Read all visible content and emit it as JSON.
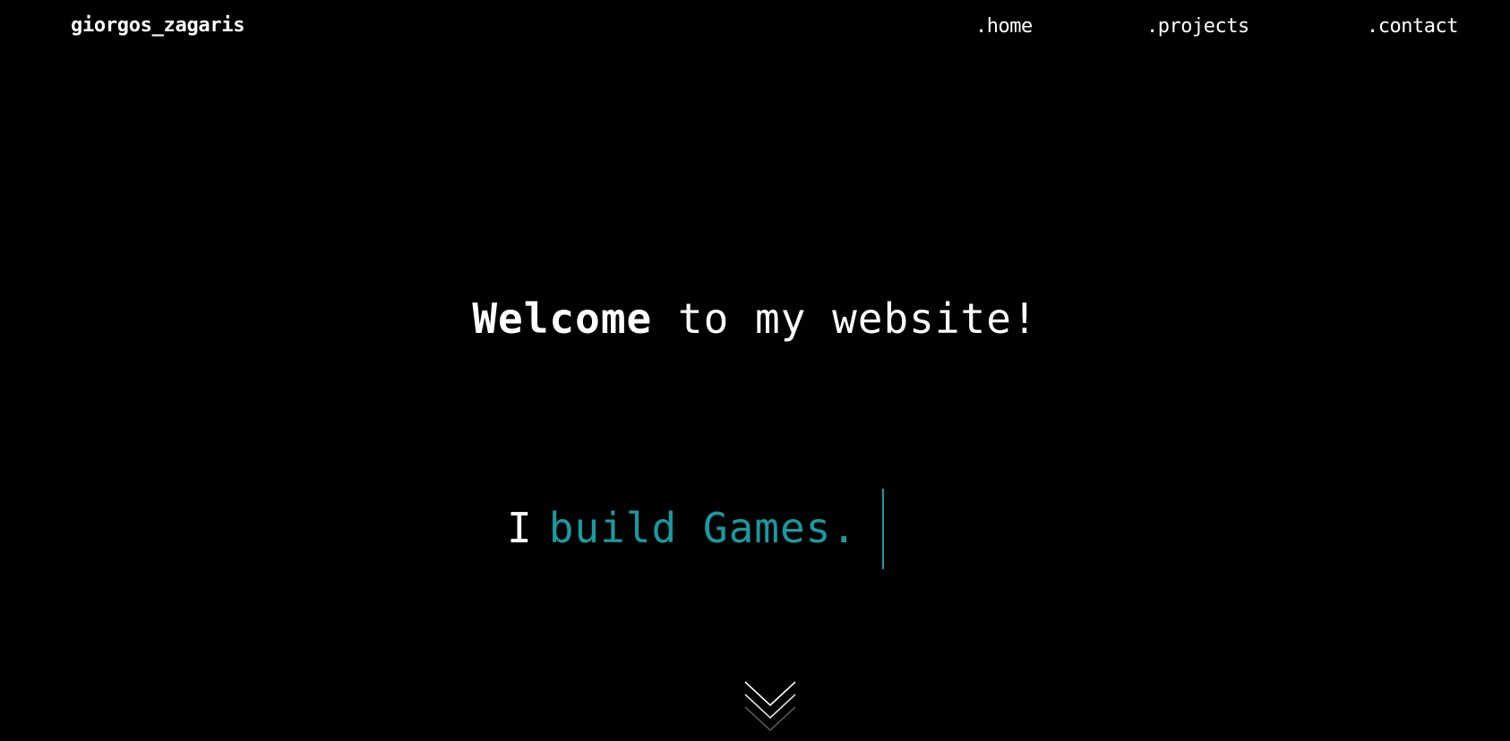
{
  "header": {
    "brand": "giorgos_zagaris",
    "nav": [
      {
        "label": ".home"
      },
      {
        "label": ".projects"
      },
      {
        "label": ".contact"
      }
    ]
  },
  "hero": {
    "welcome_strong": "Welcome",
    "welcome_rest": "to my website!",
    "tagline_prefix": "I",
    "tagline_typed": "build Games."
  },
  "icons": {
    "scroll": "chevron-double-down-icon"
  },
  "colors": {
    "background": "#000000",
    "text": "#ffffff",
    "accent": "#1a9aa0"
  }
}
